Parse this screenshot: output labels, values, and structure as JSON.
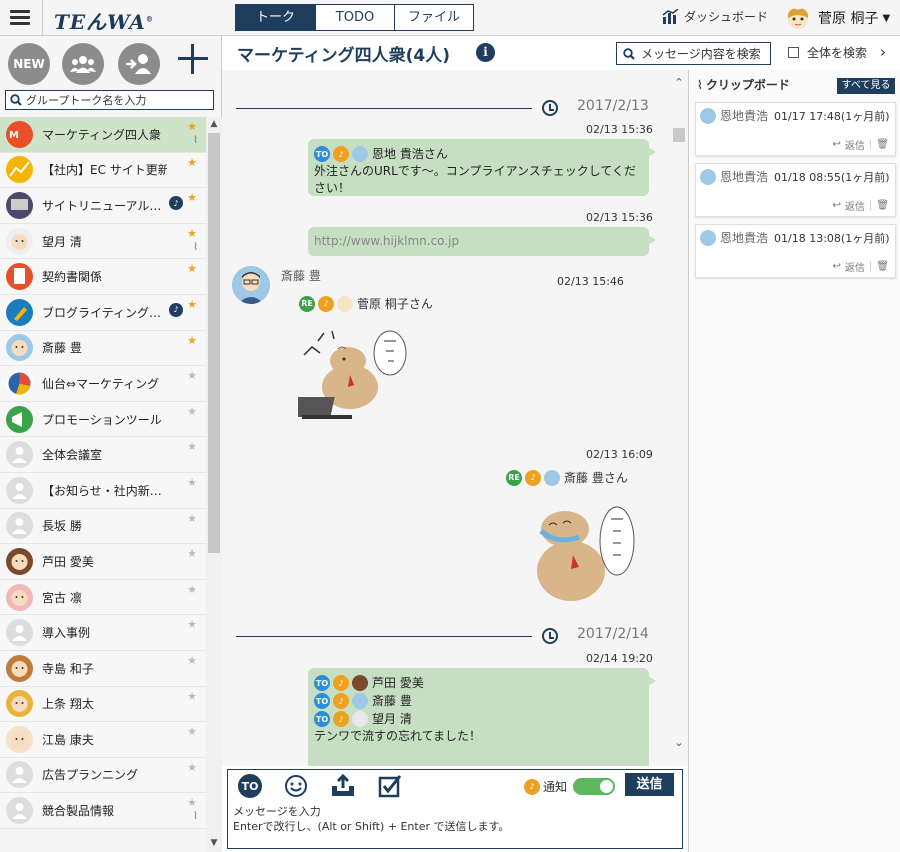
{
  "header": {
    "logo": "TEんWA",
    "logo_mark": "®",
    "tabs": [
      "トーク",
      "TODO",
      "ファイル"
    ],
    "dashboard": "ダッシュボード",
    "user_name": "菅原 桐子"
  },
  "sidebar": {
    "new_label": "NEW",
    "search_placeholder": "グループトーク名を入力",
    "items": [
      {
        "name": "マーケティング四人衆",
        "star": true,
        "clip": true,
        "avatar": "logo",
        "color": "#e8502a"
      },
      {
        "name": "【社内】EC サイト更新",
        "star": true,
        "clip": false,
        "avatar": "chart",
        "color": "#f4b400"
      },
      {
        "name": "サイトリニューアル…",
        "star": true,
        "clip": false,
        "bell": true,
        "avatar": "monitor",
        "color": "#4a4a6a"
      },
      {
        "name": "望月 清",
        "star": true,
        "clip": true,
        "avatar": "face",
        "color": "#eeeeee"
      },
      {
        "name": "契約書関係",
        "star": true,
        "clip": false,
        "avatar": "doc",
        "color": "#e8502a"
      },
      {
        "name": "ブログライティング…",
        "star": true,
        "clip": false,
        "bell": true,
        "avatar": "pen",
        "color": "#1a7bbf"
      },
      {
        "name": "斎藤 豊",
        "star": true,
        "clip": false,
        "avatar": "face",
        "color": "#9ec9e6"
      },
      {
        "name": "仙台⇔マーケティング",
        "star": false,
        "clip": false,
        "avatar": "pie",
        "color": "#2a64b0"
      },
      {
        "name": "プロモーションツール",
        "star": false,
        "clip": false,
        "avatar": "mega",
        "color": "#3aa34a"
      },
      {
        "name": "全体会議室",
        "star": false,
        "clip": false,
        "avatar": "group",
        "color": "#dddddd"
      },
      {
        "name": "【お知らせ・社内新…",
        "star": false,
        "clip": false,
        "avatar": "group",
        "color": "#dddddd"
      },
      {
        "name": "長坂 勝",
        "star": false,
        "clip": false,
        "avatar": "group",
        "color": "#dddddd"
      },
      {
        "name": "芦田 愛美",
        "star": false,
        "clip": false,
        "avatar": "face",
        "color": "#7a4a2a"
      },
      {
        "name": "宮古 凛",
        "star": false,
        "clip": false,
        "avatar": "face",
        "color": "#f0b8b8"
      },
      {
        "name": "導入事例",
        "star": false,
        "clip": false,
        "avatar": "group",
        "color": "#dddddd"
      },
      {
        "name": "寺島 和子",
        "star": false,
        "clip": false,
        "avatar": "face",
        "color": "#c07a3a"
      },
      {
        "name": "上条 翔太",
        "star": false,
        "clip": false,
        "avatar": "face",
        "color": "#e8b43a"
      },
      {
        "name": "江島 康夫",
        "star": false,
        "clip": false,
        "avatar": "face",
        "color": "#f5e0c8"
      },
      {
        "name": "広告プランニング",
        "star": false,
        "clip": false,
        "avatar": "group",
        "color": "#dddddd"
      },
      {
        "name": "競合製品情報",
        "star": false,
        "clip": true,
        "avatar": "group",
        "color": "#dddddd"
      }
    ]
  },
  "chat": {
    "title": "マーケティング四人衆(4人)",
    "search_button": "メッセージ内容を検索",
    "search_all": "全体を検索",
    "date1": "2017/2/13",
    "date2": "2017/2/14",
    "msg1": {
      "time": "02/13 15:36",
      "to_name": "恩地 貴浩さん",
      "text": "外注さんのURLです〜。コンプライアンスチェックしてください！"
    },
    "msg2": {
      "time": "02/13 15:36",
      "text": "http://www.hijklmn.co.jp"
    },
    "msg3": {
      "time": "02/13 15:46",
      "sender": "斎藤 豊",
      "re_name": "菅原 桐子さん"
    },
    "msg4": {
      "time": "02/13 16:09",
      "re_name": "斎藤 豊さん"
    },
    "msg5": {
      "time": "02/14 19:20",
      "to1": "芦田 愛美",
      "to2": "斎藤 豊",
      "to3": "望月 清",
      "text": "テンワで流すの忘れてました！"
    },
    "to_tag": "TO",
    "re_tag": "RE"
  },
  "composer": {
    "to_label": "TO",
    "notify": "通知",
    "send": "送信",
    "placeholder_line1": "メッセージを入力",
    "placeholder_line2": "Enterで改行し、(Alt or Shift) + Enter で送信します。"
  },
  "clipboard": {
    "title": "クリップボード",
    "see_all": "すべて見る",
    "reply": "返信",
    "cards": [
      {
        "name": "恩地貴浩",
        "time": "01/17 17:48(1ヶ月前)"
      },
      {
        "name": "恩地貴浩",
        "time": "01/18 08:55(1ヶ月前)"
      },
      {
        "name": "恩地貴浩",
        "time": "01/18 13:08(1ヶ月前)"
      }
    ]
  },
  "colors": {
    "accent": "#1f3d5c",
    "bubble": "#c6dfc3",
    "star": "#f0a020",
    "toggle": "#5cb85c"
  }
}
